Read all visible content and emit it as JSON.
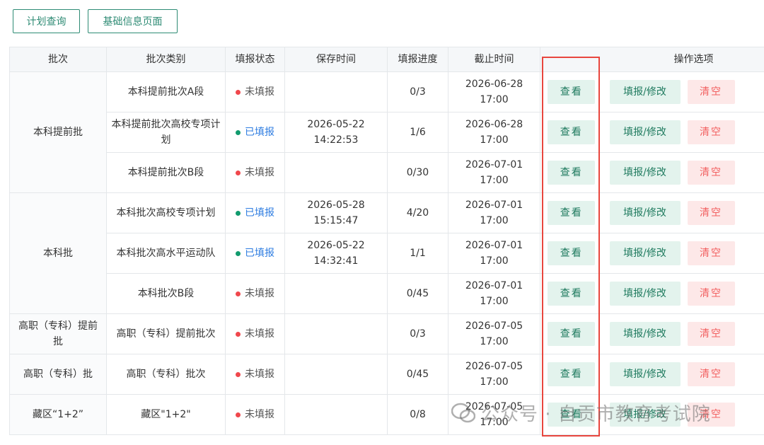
{
  "toolbar": {
    "plan_query": "计划查询",
    "basic_info": "基础信息页面"
  },
  "table": {
    "headers": {
      "batch": "批次",
      "batch_type": "批次类别",
      "fill_status": "填报状态",
      "save_time": "保存时间",
      "progress": "填报进度",
      "deadline": "截止时间",
      "operations": "操作选项"
    },
    "groups": [
      {
        "label": "本科提前批"
      },
      {
        "label": "本科批"
      },
      {
        "label": "高职（专科）提前批"
      },
      {
        "label": "高职（专科）批"
      },
      {
        "label": "藏区“1+2”"
      }
    ],
    "rows": [
      {
        "type": "本科提前批次A段",
        "status": "未填报",
        "status_color": "#f0474c",
        "save_date": "",
        "save_time": "",
        "progress": "0/3",
        "deadline_date": "2026-06-28",
        "deadline_time": "17:00"
      },
      {
        "type": "本科提前批次高校专项计划",
        "status": "已填报",
        "status_color": "#129b6e",
        "save_date": "2026-05-22",
        "save_time": "14:22:53",
        "progress": "1/6",
        "deadline_date": "2026-06-28",
        "deadline_time": "17:00"
      },
      {
        "type": "本科提前批次B段",
        "status": "未填报",
        "status_color": "#f0474c",
        "save_date": "",
        "save_time": "",
        "progress": "0/30",
        "deadline_date": "2026-07-01",
        "deadline_time": "17:00"
      },
      {
        "type": "本科批次高校专项计划",
        "status": "已填报",
        "status_color": "#129b6e",
        "save_date": "2026-05-28",
        "save_time": "15:15:47",
        "progress": "4/20",
        "deadline_date": "2026-07-01",
        "deadline_time": "17:00"
      },
      {
        "type": "本科批次高水平运动队",
        "status": "已填报",
        "status_color": "#129b6e",
        "save_date": "2026-05-22",
        "save_time": "14:32:41",
        "progress": "1/1",
        "deadline_date": "2026-07-01",
        "deadline_time": "17:00"
      },
      {
        "type": "本科批次B段",
        "status": "未填报",
        "status_color": "#f0474c",
        "save_date": "",
        "save_time": "",
        "progress": "0/45",
        "deadline_date": "2026-07-01",
        "deadline_time": "17:00"
      },
      {
        "type": "高职（专科）提前批次",
        "status": "未填报",
        "status_color": "#f0474c",
        "save_date": "",
        "save_time": "",
        "progress": "0/3",
        "deadline_date": "2026-07-05",
        "deadline_time": "17:00"
      },
      {
        "type": "高职（专科）批次",
        "status": "未填报",
        "status_color": "#f0474c",
        "save_date": "",
        "save_time": "",
        "progress": "0/45",
        "deadline_date": "2026-07-05",
        "deadline_time": "17:00"
      },
      {
        "type": "藏区\"1+2\"",
        "status": "未填报",
        "status_color": "#f0474c",
        "save_date": "",
        "save_time": "",
        "progress": "0/8",
        "deadline_date": "2026-07-05",
        "deadline_time": "17:00"
      }
    ]
  },
  "actions": {
    "view": "查看",
    "edit": "填报/修改",
    "clear": "清空"
  },
  "watermark": {
    "text": "公众号 · 自贡市教育考试院"
  },
  "colors": {
    "accent": "#2e8b74",
    "highlight_box": "#e8463e",
    "done_text": "#2f7de1"
  }
}
